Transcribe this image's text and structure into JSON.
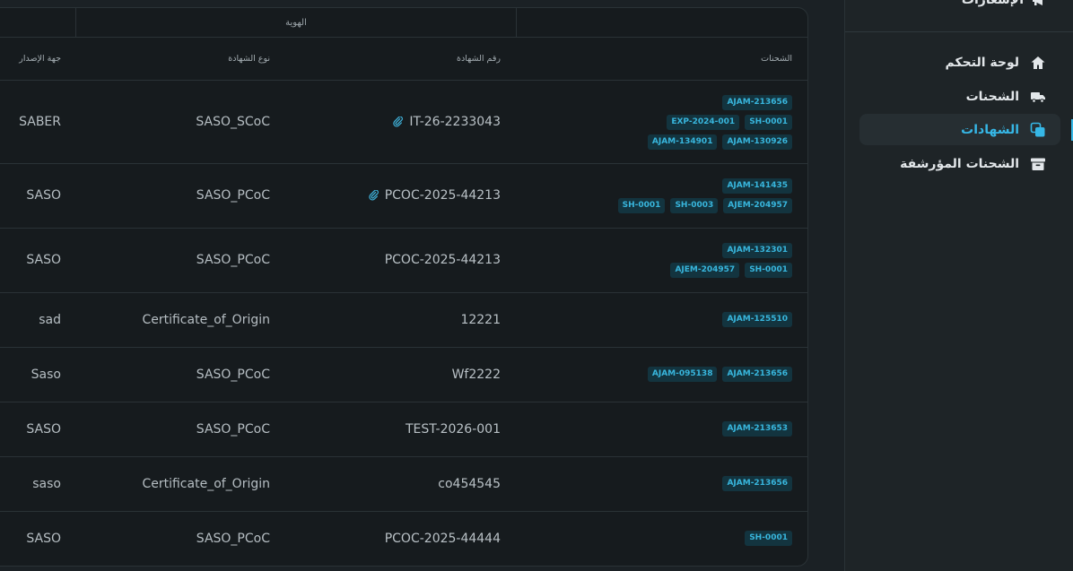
{
  "table": {
    "group_header": "الهوية",
    "columns": {
      "shipments": "الشحنات",
      "certificate_number": "رقم الشهادة",
      "certificate_type": "نوع الشهادة",
      "issuer": "جهة الإصدار"
    },
    "rows": [
      {
        "shipments": [
          "AJAM-130926",
          "AJAM-134901",
          "SH-0001",
          "EXP-2024-001",
          "AJAM-213656"
        ],
        "number": "IT-26-2233043",
        "attachment": true,
        "type": "SASO_SCoC",
        "issuer": "SABER"
      },
      {
        "shipments": [
          "AJEM-204957",
          "SH-0003",
          "SH-0001",
          "AJAM-141435"
        ],
        "number": "PCOC-2025-44213",
        "attachment": true,
        "type": "SASO_PCoC",
        "issuer": "SASO"
      },
      {
        "shipments": [
          "SH-0001",
          "AJEM-204957",
          "AJAM-132301"
        ],
        "number": "PCOC-2025-44213",
        "attachment": false,
        "type": "SASO_PCoC",
        "issuer": "SASO"
      },
      {
        "shipments": [
          "AJAM-125510"
        ],
        "number": "12221",
        "attachment": false,
        "type": "Certificate_of_Origin",
        "issuer": "sad"
      },
      {
        "shipments": [
          "AJAM-213656",
          "AJAM-095138"
        ],
        "number": "Wf2222",
        "attachment": false,
        "type": "SASO_PCoC",
        "issuer": "Saso"
      },
      {
        "shipments": [
          "AJAM-213653"
        ],
        "number": "TEST-2026-001",
        "attachment": false,
        "type": "SASO_PCoC",
        "issuer": "SASO"
      },
      {
        "shipments": [
          "AJAM-213656"
        ],
        "number": "co454545",
        "attachment": false,
        "type": "Certificate_of_Origin",
        "issuer": "saso"
      },
      {
        "shipments": [
          "SH-0001"
        ],
        "number": "PCOC-2025-44444",
        "attachment": false,
        "type": "SASO_PCoC",
        "issuer": "SASO"
      }
    ]
  },
  "sidebar": {
    "notifications_label": "الإشعارات",
    "items": [
      {
        "label": "لوحة التحكم",
        "icon": "home-icon",
        "active": false
      },
      {
        "label": "الشحنات",
        "icon": "truck-icon",
        "active": false
      },
      {
        "label": "الشهادات",
        "icon": "copy-icon",
        "active": true
      },
      {
        "label": "الشحنات المؤرشفة",
        "icon": "archive-icon",
        "active": false
      }
    ]
  },
  "colors": {
    "accent": "#36b7e6",
    "tag_bg": "#13343f",
    "tag_text": "#38b6dd"
  }
}
